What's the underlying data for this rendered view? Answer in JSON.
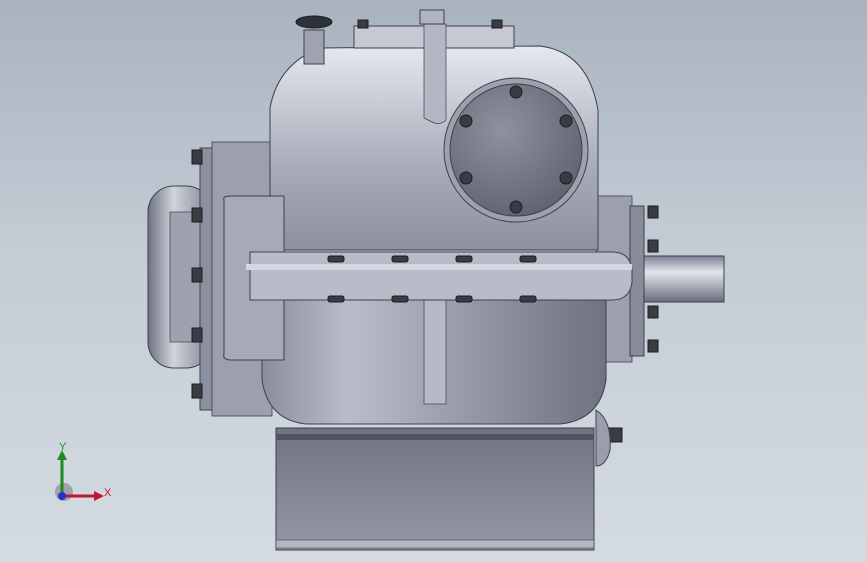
{
  "viewport": {
    "background_top": "#a9b3bf",
    "background_bottom": "#d4dbe2"
  },
  "model": {
    "body_color": "#7e8190",
    "highlight_color": "#c9cbd6",
    "shadow_color": "#5d606d",
    "bolt_color": "#3a3c44"
  },
  "triad": {
    "x_label": "X",
    "y_label": "Y",
    "x_color": "#c0182a",
    "y_color": "#1d8a25",
    "z_color": "#2331c4"
  }
}
